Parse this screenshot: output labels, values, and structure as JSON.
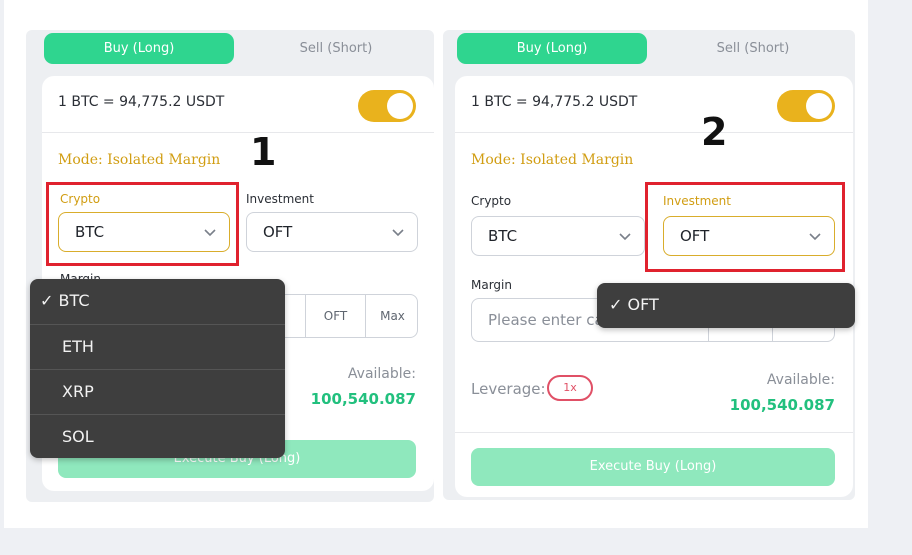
{
  "tabs": {
    "buy": "Buy (Long)",
    "sell": "Sell (Short)"
  },
  "rate": "1 BTC = 94,775.2 USDT",
  "mode": "Mode: Isolated Margin",
  "labels": {
    "crypto": "Crypto",
    "investment": "Investment",
    "margin": "Margin",
    "leverage": "Leverage:",
    "available": "Available:"
  },
  "steps": [
    "1",
    "2"
  ],
  "crypto_value": "BTC",
  "investment_value": "OFT",
  "margin_buttons": [
    "OFT",
    "Max"
  ],
  "margin_placeholder": "Please enter ca",
  "leverage_value": "1x",
  "available_value": "100,540.087",
  "execute_label": "Execute Buy (Long)",
  "crypto_dropdown": {
    "options": [
      "BTC",
      "ETH",
      "XRP",
      "SOL"
    ],
    "selected": "BTC",
    "checkmark": "✓"
  },
  "investment_dropdown": {
    "options": [
      "OFT"
    ],
    "selected": "OFT",
    "checkmark": "✓"
  },
  "colors": {
    "green": "#2fd58f",
    "gold": "#d19d12",
    "highlight": "#e0222e",
    "toggle": "#e9b21d"
  },
  "toggle_on": true
}
